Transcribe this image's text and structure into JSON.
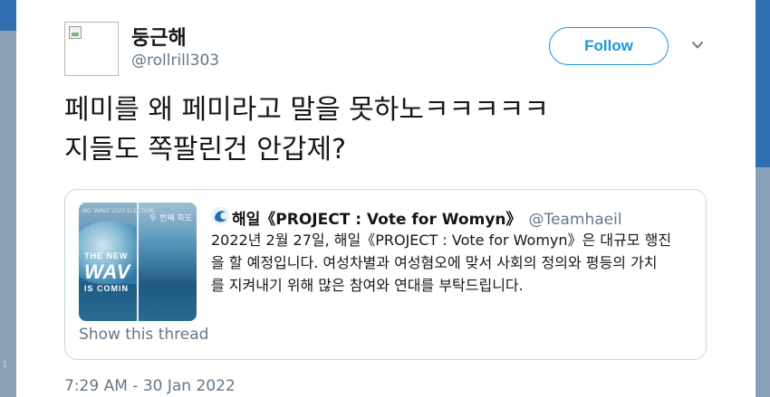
{
  "backdrop": {
    "left_number": "1"
  },
  "author": {
    "display_name": "둥근해",
    "handle": "@rollrill303"
  },
  "follow_label": "Follow",
  "tweet": {
    "lines": [
      "페미를 왜 페미라고 말을 못하노ㅋㅋㅋㅋㅋ",
      "지들도 쪽팔린건 안갑제?"
    ]
  },
  "quote": {
    "name": "해일《PROJECT : Vote for Womyn》",
    "handle": "@Teamhaeil",
    "body_lines": [
      "2022년 2월 27일, 해일《PROJECT : Vote for Womyn》은 대규모 행진",
      "을 할 예정입니다. 여성차별과 여성혐오에 맞서 사회의 정의와 평등의 가치",
      "를 지켜내기 위해 많은 참여와 연대를 부탁드립니다."
    ],
    "media": {
      "top_text": "NO. WAVE 2022 ELECTION",
      "caption_top": "THE NEW",
      "caption_main": "WAV",
      "caption_bottom": "IS COMIN",
      "right_top_text": "두 번째 파도"
    },
    "show_thread_label": "Show this thread"
  },
  "timestamp": "7:29 AM - 30 Jan 2022",
  "colors": {
    "accent": "#1b95e0",
    "secondary_text": "#657786",
    "primary_text": "#14171a",
    "border": "#ccd6dd"
  },
  "icons": {
    "more": "chevron-down-icon",
    "avatar": "broken-image-icon",
    "quote_avatar": "wave-logo-icon"
  }
}
